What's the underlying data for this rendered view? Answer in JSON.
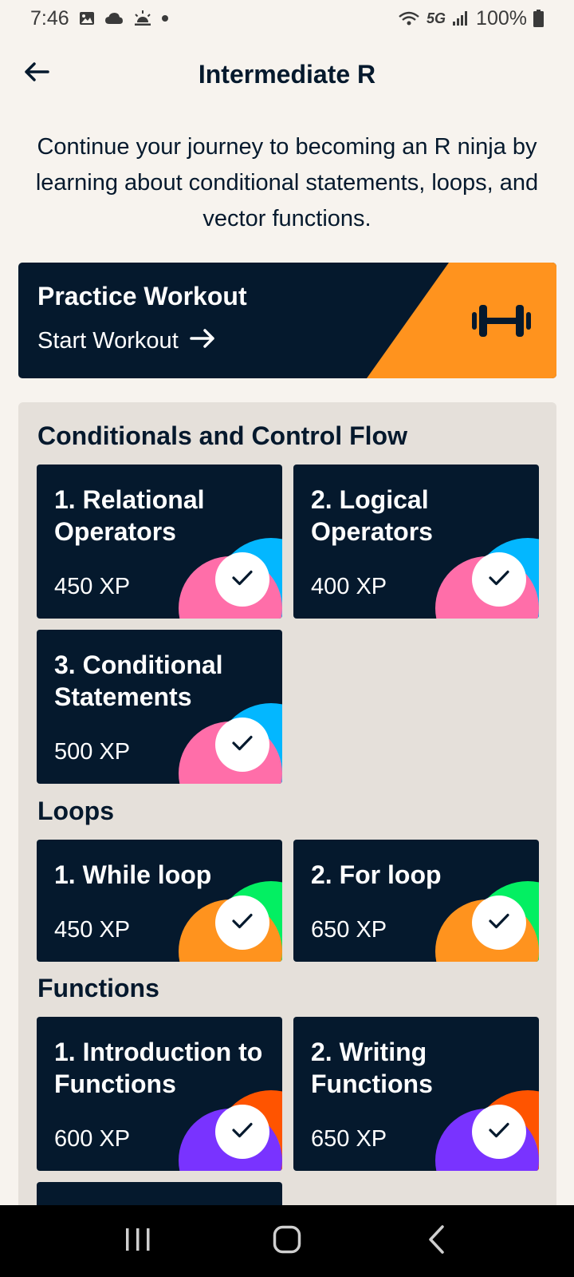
{
  "status_bar": {
    "time": "7:46",
    "network": "5G",
    "battery": "100%"
  },
  "header": {
    "title": "Intermediate R"
  },
  "description": "Continue your journey to becoming an R ninja by learning about conditional statements, loops, and vector functions.",
  "workout": {
    "title": "Practice Workout",
    "link_label": "Start Workout",
    "accent_color": "#ff931e"
  },
  "sections": [
    {
      "title": "Conditionals and Control Flow",
      "accent_colors": [
        "#ff6ea9",
        "#03b7ff"
      ],
      "lessons": [
        {
          "title": "1. Relational Operators",
          "xp": "450 XP",
          "completed": true
        },
        {
          "title": "2. Logical Operators",
          "xp": "400 XP",
          "completed": true
        },
        {
          "title": "3. Conditional Statements",
          "xp": "500 XP",
          "completed": true
        }
      ]
    },
    {
      "title": "Loops",
      "accent_colors": [
        "#ff931e",
        "#03ef62"
      ],
      "lessons": [
        {
          "title": "1. While loop",
          "xp": "450 XP",
          "completed": true
        },
        {
          "title": "2. For loop",
          "xp": "650 XP",
          "completed": true
        }
      ]
    },
    {
      "title": "Functions",
      "accent_colors": [
        "#7933ff",
        "#ff5400",
        "#fcce0d"
      ],
      "lessons": [
        {
          "title": "1. Introduction to Functions",
          "xp": "600 XP",
          "completed": true
        },
        {
          "title": "2. Writing Functions",
          "xp": "650 XP",
          "completed": true
        }
      ]
    }
  ],
  "icons": {
    "back": "arrow-left-icon",
    "workout_arrow": "arrow-right-icon",
    "workout": "dumbbell-icon",
    "completed": "checkmark-icon",
    "nav_recents": "recents-icon",
    "nav_home": "home-icon",
    "nav_back": "chevron-left-icon"
  }
}
